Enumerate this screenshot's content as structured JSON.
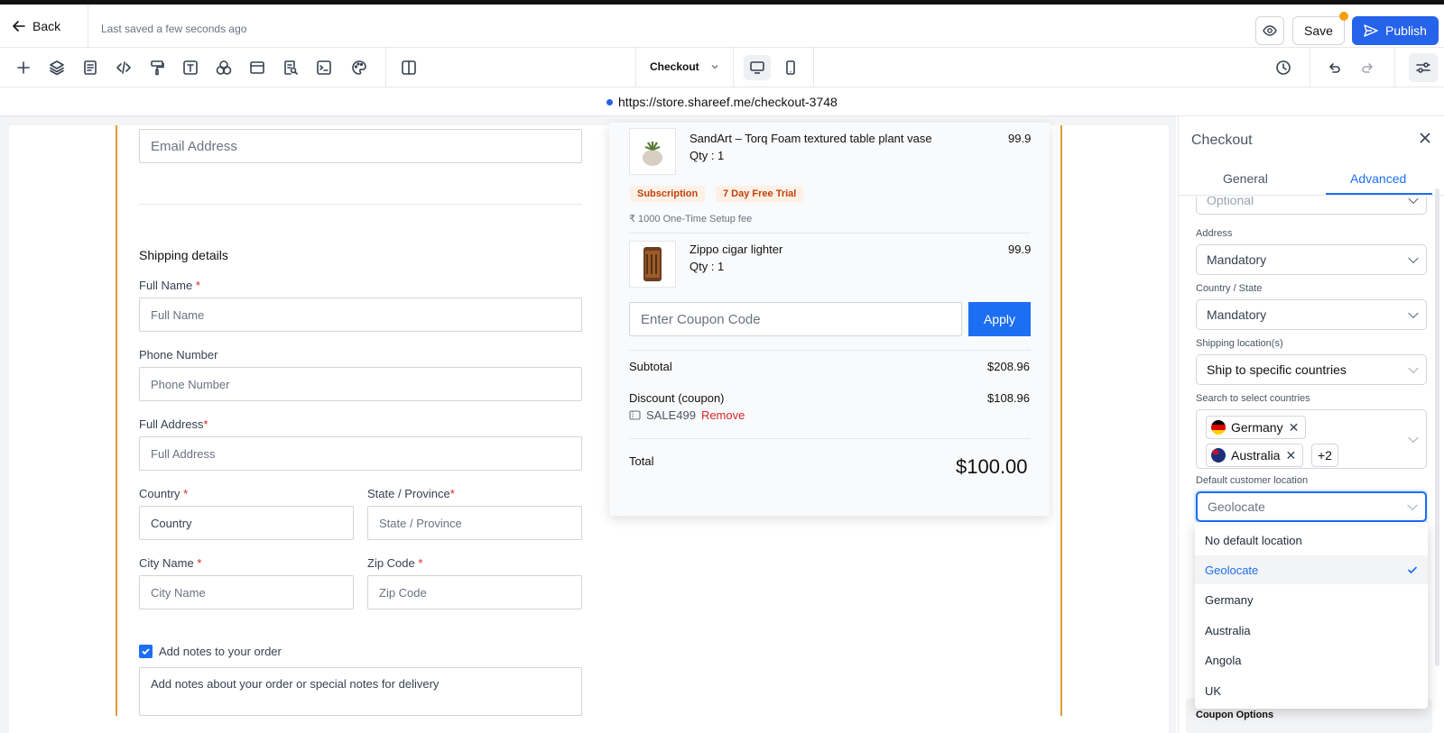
{
  "header": {
    "back_label": "Back",
    "saved_status": "Last saved a few seconds ago",
    "save_label": "Save",
    "publish_label": "Publish"
  },
  "toolbar": {
    "tools": [
      "plus-icon",
      "layers-icon",
      "page-icon",
      "code-icon",
      "paint-roller-icon",
      "text-icon",
      "shapes-icon",
      "layout-icon",
      "search-doc-icon",
      "terminal-icon",
      "palette-icon",
      "split-view-icon"
    ],
    "page_select": "Checkout"
  },
  "url": "https://store.shareef.me/checkout-3748",
  "form": {
    "email_placeholder": "Email Address",
    "shipping_title": "Shipping details",
    "full_name_label": "Full Name",
    "full_name_placeholder": "Full Name",
    "phone_label": "Phone Number",
    "phone_placeholder": "Phone Number",
    "address_label": "Full Address",
    "address_placeholder": "Full Address",
    "country_label": "Country",
    "country_value": "Country",
    "state_label": "State / Province",
    "state_placeholder": "State / Province",
    "city_label": "City Name",
    "city_placeholder": "City Name",
    "zip_label": "Zip Code",
    "zip_placeholder": "Zip Code",
    "notes_checkbox_label": "Add notes to your order",
    "notes_placeholder": "Add notes about your order or special notes for delivery",
    "required_mark": "*"
  },
  "summary": {
    "items": [
      {
        "title": "SandArt – Torq Foam textured table plant vase",
        "qty": "Qty : 1",
        "price": "99.9"
      },
      {
        "title": "Zippo cigar lighter",
        "qty": "Qty : 1",
        "price": "99.9"
      }
    ],
    "badges": [
      "Subscription",
      "7 Day Free Trial"
    ],
    "setup_fee": "₹ 1000 One-Time Setup fee",
    "coupon_placeholder": "Enter Coupon Code",
    "apply_label": "Apply",
    "subtotal_label": "Subtotal",
    "subtotal_value": "$208.96",
    "discount_label": "Discount (coupon)",
    "discount_value": "$108.96",
    "coupon_code": "SALE499",
    "remove_label": "Remove",
    "total_label": "Total",
    "total_value": "$100.00"
  },
  "panel": {
    "title": "Checkout",
    "tabs": [
      "General",
      "Advanced"
    ],
    "active_tab": "Advanced",
    "prev_select_value": "Optional",
    "address_label": "Address",
    "address_value": "Mandatory",
    "country_state_label": "Country / State",
    "country_state_value": "Mandatory",
    "shipping_loc_label": "Shipping location(s)",
    "shipping_loc_value": "Ship to specific countries",
    "search_countries_label": "Search to select countries",
    "chips": [
      "Germany",
      "Australia"
    ],
    "more_chips": "+2",
    "default_loc_label": "Default customer location",
    "default_loc_value": "Geolocate",
    "options": [
      "No default location",
      "Geolocate",
      "Germany",
      "Australia",
      "Angola",
      "UK"
    ],
    "selected_option": "Geolocate",
    "coupon_options_label": "Coupon Options"
  },
  "colors": {
    "accent": "#1d6ff2",
    "publish": "#2563eb",
    "orange_border": "#e39a3a",
    "badge_text": "#c2410c",
    "required": "#dc2626",
    "notification_dot": "#f59e0b"
  }
}
